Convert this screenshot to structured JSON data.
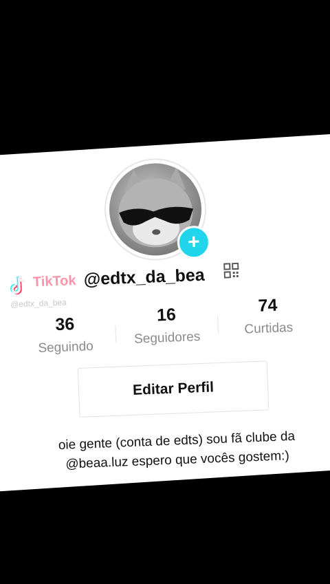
{
  "watermark": {
    "brand": "TikTok",
    "username": "@edtx_da_bea"
  },
  "profile": {
    "username": "@edtx_da_bea",
    "avatar_icon": "cat-with-sunglasses-avatar",
    "add_icon": "plus-icon",
    "qr_icon": "qr-code-icon"
  },
  "stats": [
    {
      "value": "36",
      "label": "Seguindo"
    },
    {
      "value": "16",
      "label": "Seguidores"
    },
    {
      "value": "74",
      "label": "Curtidas"
    }
  ],
  "edit_button": {
    "label": "Editar Perfil"
  },
  "bio": {
    "line1": "oie gente (conta de edts) sou fã clube da",
    "line2": "@beaa.luz espero que vocês gostem:)"
  },
  "colors": {
    "accent": "#20d5ec",
    "background": "#000000",
    "panel": "#ffffff"
  }
}
